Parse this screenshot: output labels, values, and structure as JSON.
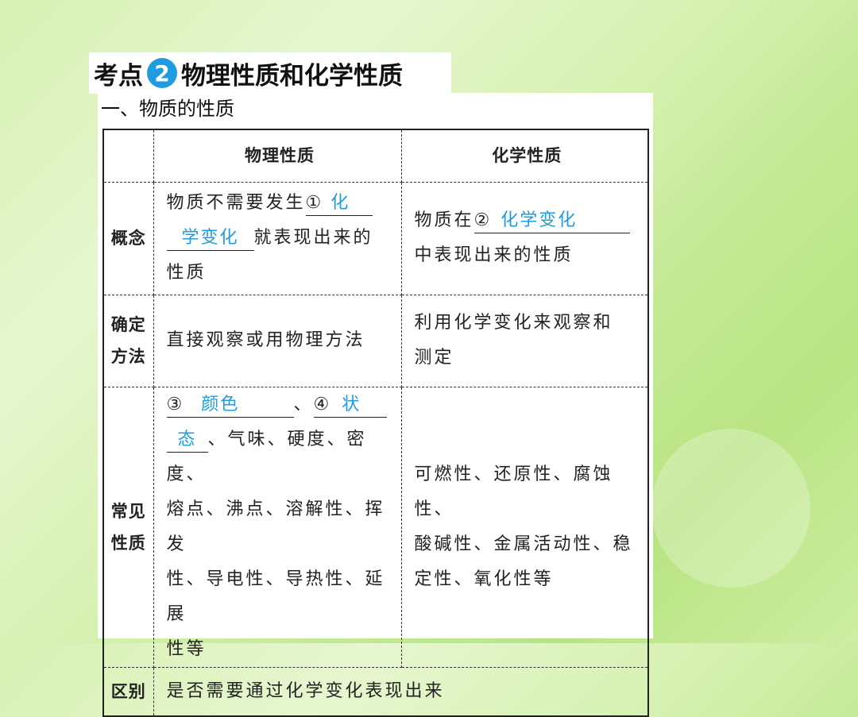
{
  "title": {
    "prefix": "考点",
    "number": "2",
    "text": "物理性质和化学性质"
  },
  "section_heading": "一、物质的性质",
  "table": {
    "headers": [
      "",
      "物理性质",
      "化学性质"
    ],
    "rows": [
      {
        "label": "概念",
        "physical": {
          "pre": "物质不需要发生",
          "mark1": "①",
          "ans1": "化",
          "ans2": "学变化",
          "post": "就表现出来的",
          "tail": "性质"
        },
        "chemical": {
          "pre": "物质在",
          "mark": "②",
          "ans": "化学变化",
          "post": "中表现出来的性质"
        }
      },
      {
        "label_line1": "确定",
        "label_line2": "方法",
        "physical": "直接观察或用物理方法",
        "chemical_line1": "利用化学变化来观察和",
        "chemical_line2": "测定"
      },
      {
        "label_line1": "常见",
        "label_line2": "性质",
        "physical": {
          "mark3": "③",
          "ans3": "颜色",
          "sep": "、",
          "mark4": "④",
          "ans4a": "状",
          "ans4b": "态",
          "rest1": "、气味、硬度、密度、",
          "rest2": "熔点、沸点、溶解性、挥发",
          "rest3": "性、导电性、导热性、延展",
          "rest4": "性等"
        },
        "chemical_line1": "可燃性、还原性、腐蚀性、",
        "chemical_line2": "酸碱性、金属活动性、稳",
        "chemical_line3": "定性、氧化性等"
      },
      {
        "label": "区别",
        "content": "是否需要通过化学变化表现出来"
      }
    ]
  }
}
